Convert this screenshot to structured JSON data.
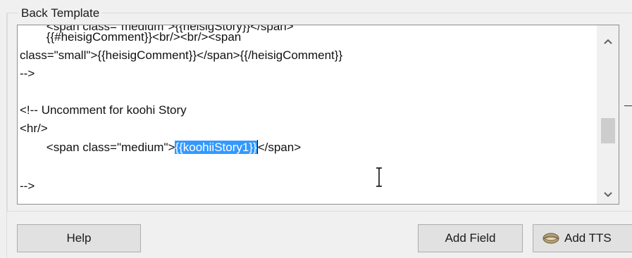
{
  "group": {
    "title": "Back Template"
  },
  "editor": {
    "lines": [
      "        <span class=\"medium\">{{heisigStory}}</span>",
      "        {{#heisigComment}}<br/><br/><span",
      "class=\"small\">{{heisigComment}}</span>{{/heisigComment}}",
      "-->",
      "",
      "<!-- Uncomment for koohi Story",
      "<hr/>",
      "        <span class=\"medium\">",
      "",
      "-->"
    ],
    "selected_text": "{{koohiiStory1}}",
    "after_selection": "</span>"
  },
  "scrollbar": {
    "up_icon": "chevron-up-icon",
    "down_icon": "chevron-down-icon"
  },
  "buttons": {
    "help": "Help",
    "add_field": "Add Field",
    "add_tts": "Add TTS"
  }
}
